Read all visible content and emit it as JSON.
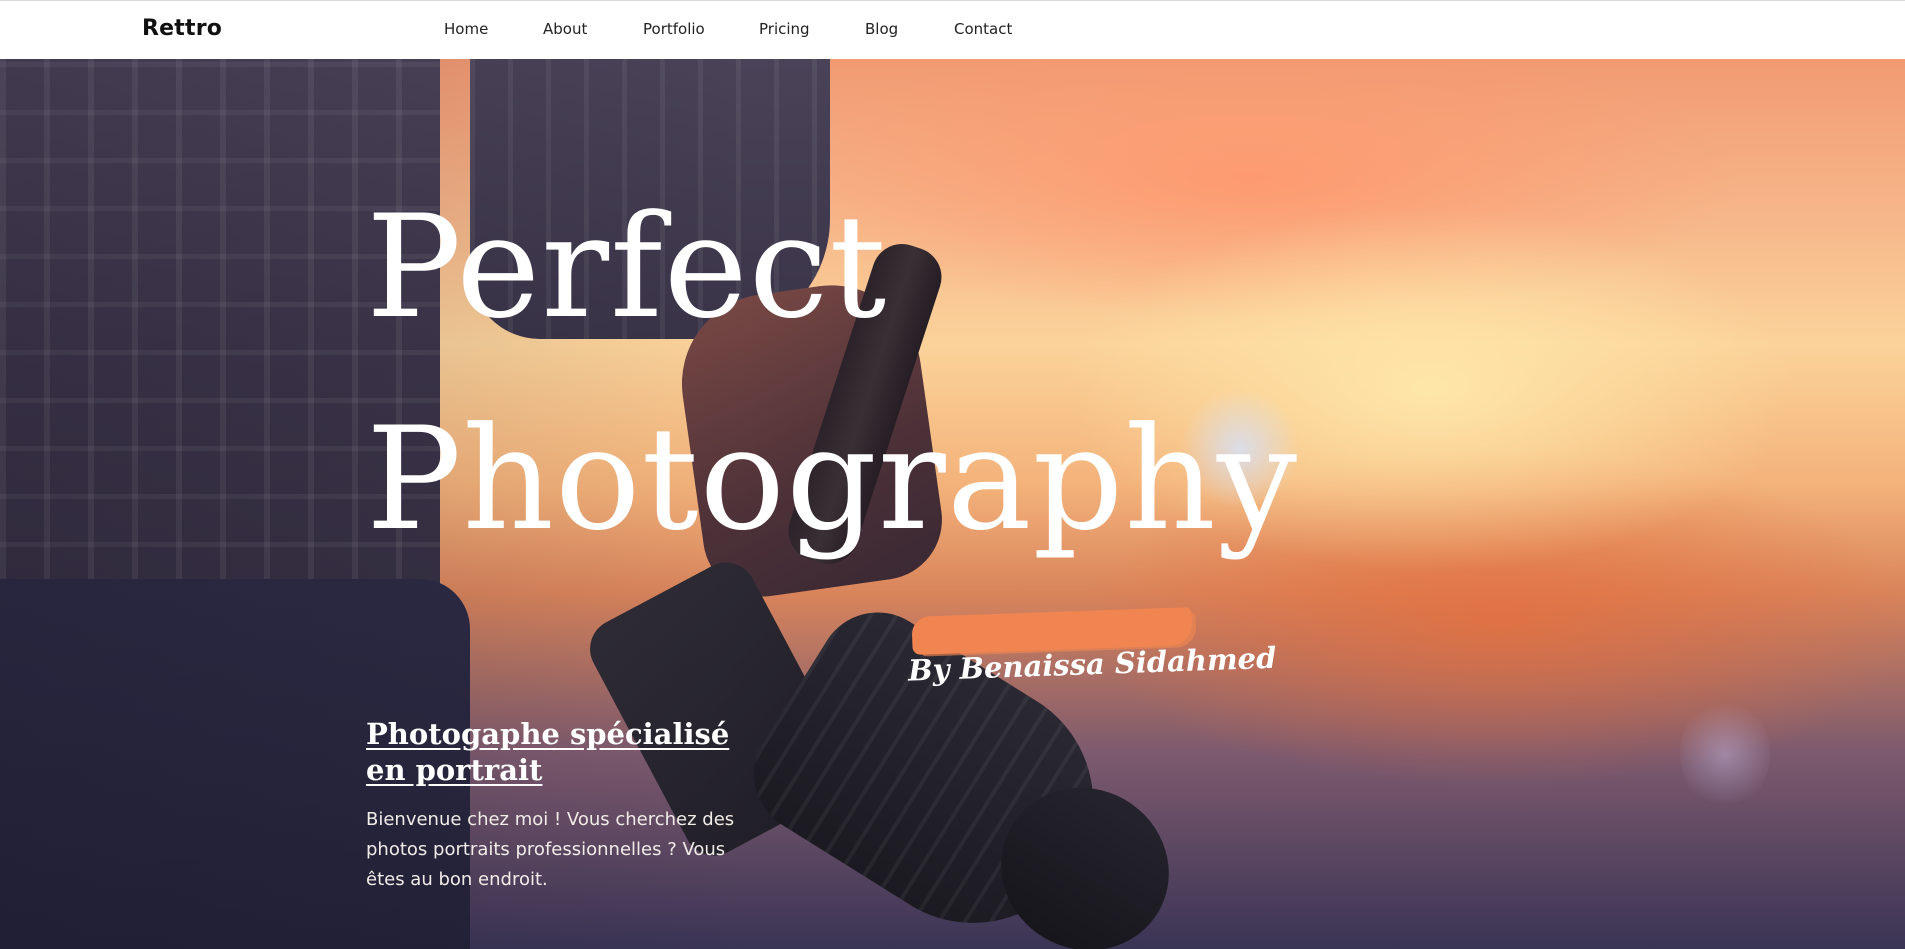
{
  "navbar": {
    "brand": "Rettro",
    "links": [
      "Home",
      "About",
      "Portfolio",
      "Pricing",
      "Blog",
      "Contact"
    ]
  },
  "hero": {
    "title_line1": "Perfect",
    "title_line2": "Photography",
    "signature": "By Benaissa Sidahmed",
    "subtitle": "Photogaphe spécialisé en portrait",
    "intro": "Bienvenue chez moi ! Vous cherchez des photos portraits professionnelles ? Vous êtes au bon endroit."
  },
  "colors": {
    "navbar_bg": "#ffffff",
    "accent_brush": "#f08552",
    "hero_text": "#ffffff"
  }
}
